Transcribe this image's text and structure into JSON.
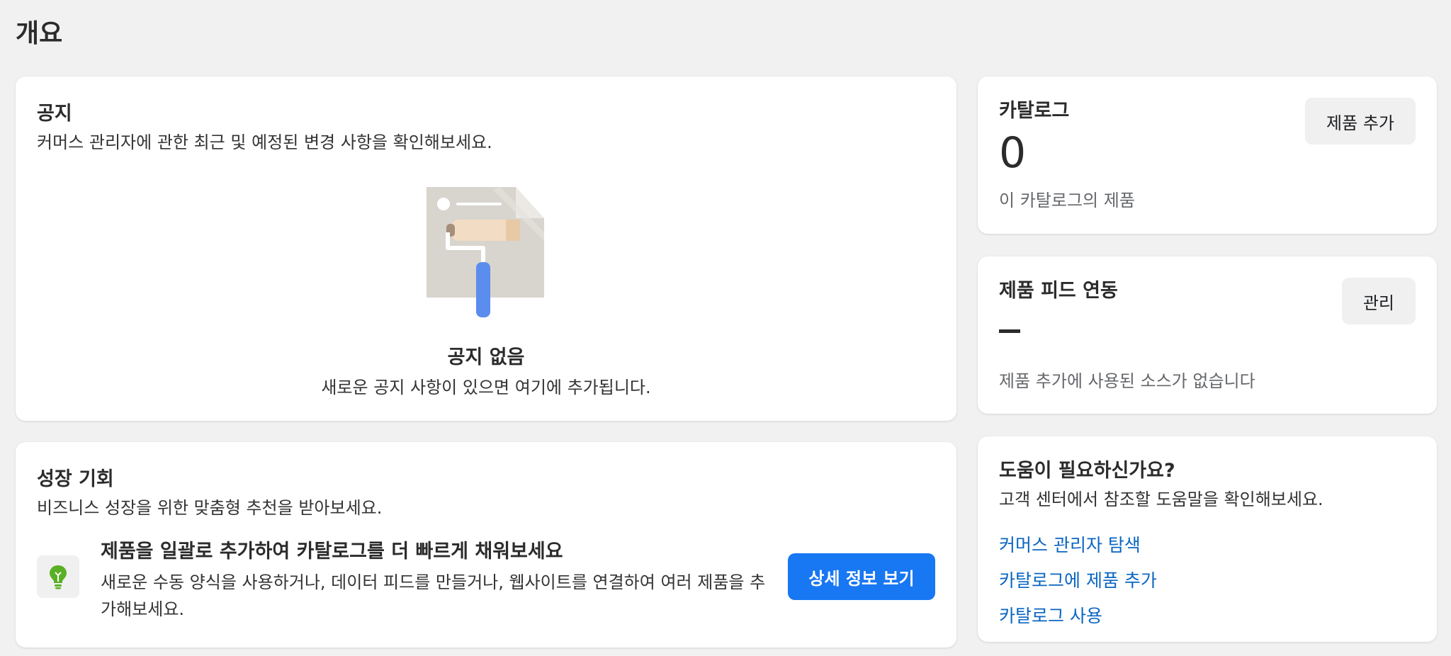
{
  "page": {
    "title": "개요"
  },
  "notices": {
    "title": "공지",
    "subtitle": "커머스 관리자에 관한 최근 및 예정된 변경 사항을 확인해보세요.",
    "empty_title": "공지 없음",
    "empty_subtitle": "새로운 공지 사항이 있으면 여기에 추가됩니다.",
    "illustration_icon": "paint-roller-icon"
  },
  "growth": {
    "title": "성장 기회",
    "subtitle": "비즈니스 성장을 위한 맞춤형 추천을 받아보세요.",
    "opportunity": {
      "icon": "lightbulb-icon",
      "title": "제품을 일괄로 추가하여 카탈로그를 더 빠르게 채워보세요",
      "description": "새로운 수동 양식을 사용하거나, 데이터 피드를 만들거나, 웹사이트를 연결하여 여러 제품을 추가해보세요.",
      "button_label": "상세 정보 보기"
    }
  },
  "catalog": {
    "title": "카탈로그",
    "value": "0",
    "caption": "이 카탈로그의 제품",
    "button_label": "제품 추가"
  },
  "feed": {
    "title": "제품 피드 연동",
    "caption": "제품 추가에 사용된 소스가 없습니다",
    "button_label": "관리"
  },
  "help": {
    "title": "도움이 필요하신가요?",
    "subtitle": "고객 센터에서 참조할 도움말을 확인해보세요.",
    "links": [
      "커머스 관리자 탐색",
      "카탈로그에 제품 추가",
      "카탈로그 사용"
    ]
  },
  "colors": {
    "background": "#f1f1f1",
    "primary": "#1877f2",
    "link": "#0a66c2",
    "bulb_green": "#5ab024"
  }
}
